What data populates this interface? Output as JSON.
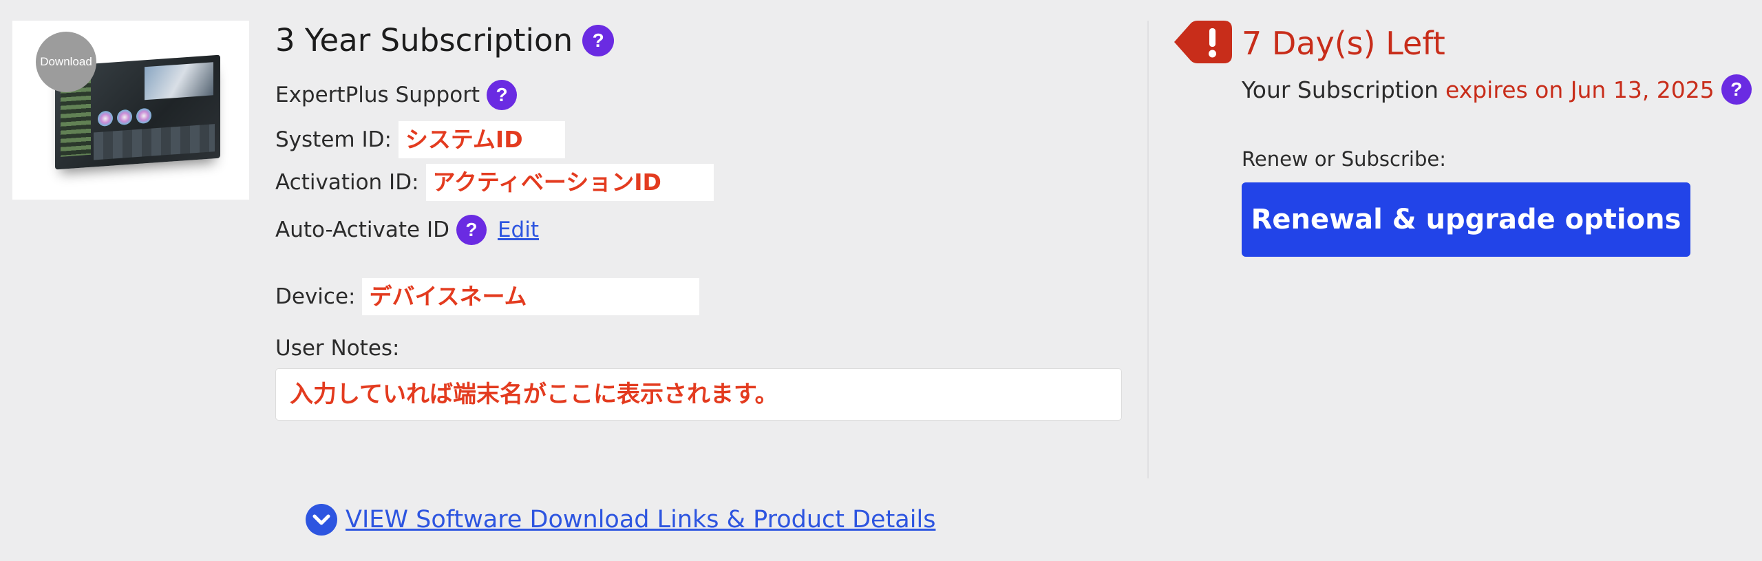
{
  "product": {
    "thumbnail_badge": "Download",
    "title": "3 Year Subscription",
    "help_glyph": "?"
  },
  "details": {
    "support_label": "ExpertPlus Support",
    "system_id_label": "System ID:",
    "system_id_value": "システムID",
    "activation_id_label": "Activation ID:",
    "activation_id_value": "アクティベーションID",
    "auto_activate_label": "Auto-Activate ID",
    "auto_activate_edit": "Edit",
    "device_label": "Device:",
    "device_value": "デバイスネーム",
    "user_notes_label": "User Notes:",
    "user_notes_value": "入力していれば端末名がここに表示されます。"
  },
  "subscription_status": {
    "days_left": "7 Day(s) Left",
    "expire_prefix": "Your Subscription",
    "expire_date_text": "expires on Jun 13, 2025",
    "renew_label": "Renew or Subscribe:",
    "renew_button": "Renewal & upgrade options"
  },
  "footer": {
    "view_links": "VIEW Software Download Links & Product Details"
  },
  "colors": {
    "background": "#ededee",
    "accent_blue": "#2244e8",
    "link_blue": "#2d55e0",
    "help_purple": "#6a2be2",
    "alert_red": "#c82d1a",
    "value_red": "#e33b1f"
  },
  "icons": {
    "help": "question-circle-icon",
    "alert": "exclamation-tag-icon",
    "expand": "chevron-down-circle-icon"
  }
}
